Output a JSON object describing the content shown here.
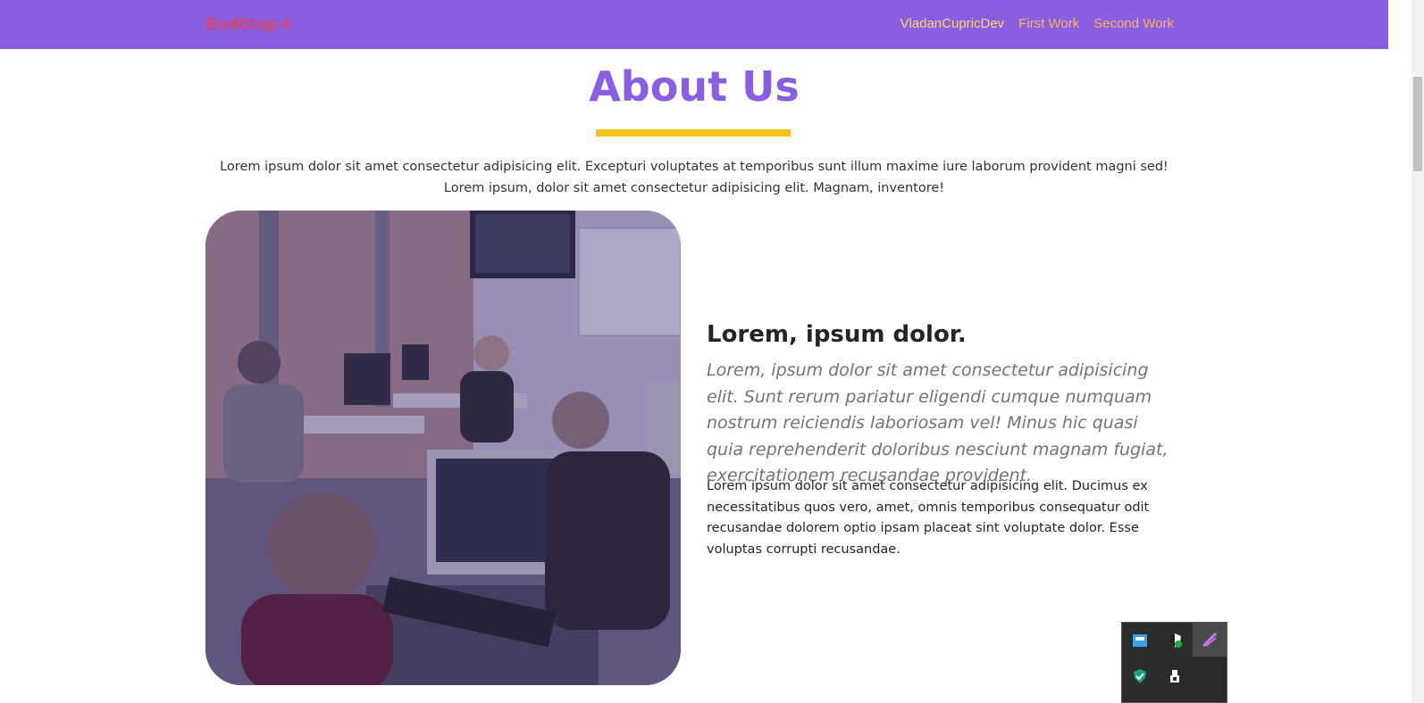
{
  "navbar": {
    "brand": "BootStrap 4",
    "links": [
      "VladanCupricDev",
      "First Work",
      "Second Work"
    ]
  },
  "about": {
    "title": "About Us",
    "intro": "Lorem ipsum dolor sit amet consectetur adipisicing elit. Excepturi voluptates at temporibus sunt illum maxime iure laborum provident magni sed! Lorem ipsum, dolor sit amet consectetur adipisicing elit. Magnam, inventore!"
  },
  "feature": {
    "heading": "Lorem, ipsum dolor.",
    "lead": "Lorem, ipsum dolor sit amet consectetur adipisicing elit. Sunt rerum pariatur eligendi cumque numquam nostrum reiciendis laboriosam vel! Minus hic quasi quia reprehenderit doloribus nesciunt magnam fugiat, exercitationem recusandae provident.",
    "body": "Lorem ipsum dolor sit amet consectetur adipisicing elit. Ducimus ex necessitatibus quos vero, amet, omnis temporibus consequatur odit recusandae dolorem optio ipsam placeat sint voluptate dolor. Esse voluptas corrupti recusandae."
  },
  "colors": {
    "navbar_bg": "#8a5ee0",
    "brand": "#ff3b3b",
    "title": "#8a5ee0",
    "underline": "#f6c31c"
  },
  "tray_icons": [
    "network-monitor-icon",
    "security-shield-icon",
    "feather-app-icon",
    "defender-check-icon",
    "usb-device-icon"
  ]
}
